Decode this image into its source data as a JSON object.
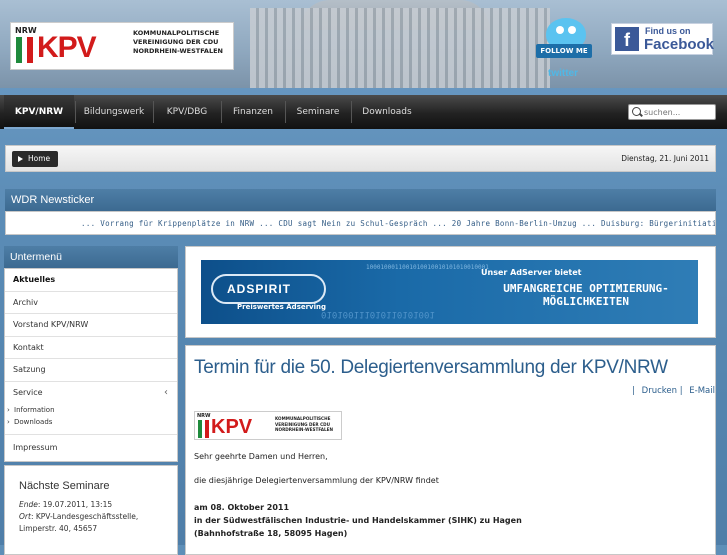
{
  "header": {
    "logo": {
      "nrw": "NRW",
      "kpv": "KPV",
      "subtitle_lines": [
        "KOMMUNALPOLITISCHE",
        "VEREINIGUNG DER CDU",
        "NORDRHEIN-WESTFALEN"
      ]
    },
    "twitter": {
      "follow": "FOLLOW ME",
      "word": "twitter"
    },
    "facebook": {
      "line1": "Find us on",
      "line2": "Facebook"
    }
  },
  "nav": {
    "items": [
      {
        "label": "KPV/NRW",
        "active": true
      },
      {
        "label": "Bildungswerk"
      },
      {
        "label": "KPV/DBG"
      },
      {
        "label": "Finanzen"
      },
      {
        "label": "Seminare"
      },
      {
        "label": "Downloads"
      }
    ],
    "search_placeholder": "suchen..."
  },
  "breadcrumb": {
    "home": "Home",
    "date": "Dienstag, 21. Juni 2011"
  },
  "newsticker": {
    "title": "WDR Newsticker",
    "text": "... Vorrang für Krippenplätze in NRW ... CDU sagt Nein zu Schul-Gespräch ... 20 Jahre Bonn-Berlin-Umzug ... Duisburg: Bürgerinitiativen woll"
  },
  "sidebar": {
    "title": "Untermenü",
    "items": [
      {
        "label": "Aktuelles",
        "active": true
      },
      {
        "label": "Archiv"
      },
      {
        "label": "Vorstand KPV/NRW"
      },
      {
        "label": "Kontakt"
      },
      {
        "label": "Satzung"
      },
      {
        "label": "Service"
      }
    ],
    "service_sub": [
      "Information",
      "Downloads"
    ],
    "impressum": "Impressum",
    "seminare": {
      "title": "Nächste Seminare",
      "ende_label": "Ende",
      "ende_value": ": 19.07.2011, 13:15",
      "ort_label": "Ort",
      "ort_value": ": KPV-Landesgeschäftsstelle,",
      "address": "Limperstr. 40, 45657"
    }
  },
  "banner": {
    "brand": "ADSPIRIT",
    "brand_sub": "Preiswertes Adserving",
    "headline": "Unser AdServer bietet",
    "tagline": "UMFANGREICHE OPTIMIERUNG-MÖGLICHKEITEN",
    "binary": "1000100011001010010010101010010001",
    "binary2": "010100111010110101001"
  },
  "article": {
    "title": "Termin für die 50. Delegiertenversammlung der KPV/NRW",
    "tools_print": "Drucken",
    "tools_email": "E-Mail",
    "greeting": "Sehr geehrte Damen und Herren,",
    "intro": "die diesjährige Delegiertenversammlung der KPV/NRW findet",
    "date_line": "am 08. Oktober 2011",
    "place_line": "in der Südwestfälischen Industrie- und Handelskammer (SIHK) zu Hagen",
    "address_line": "(Bahnhofstraße 18, 58095 Hagen)"
  },
  "colors": {
    "accent": "#2c5e8c",
    "header_bar": "#4e7ea6",
    "brand_red": "#d21b1b",
    "flag_green": "#1f8a3c"
  }
}
